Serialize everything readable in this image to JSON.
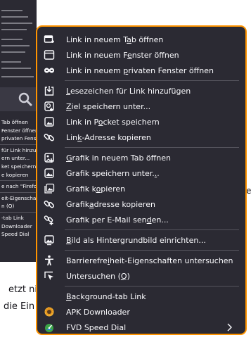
{
  "background": {
    "left_fragments": [
      "etzt nix",
      "die Ein"
    ],
    "right_fragment": "e.",
    "partial_menu_items": [
      "Tab öffnen",
      "Fenster öffnen",
      "privaten Fenst",
      "",
      "für Link hinzufü",
      "ern unter...",
      "ket speichern",
      "e kopieren",
      "",
      "e nach \"Firefox\"",
      "",
      "eit-Eigenschaften",
      "n (Q)",
      "",
      "-tab Link",
      "Downloader",
      "Speed Dial"
    ]
  },
  "context_menu": {
    "groups": [
      [
        {
          "label": "Link in neuem Tab öffnen",
          "icon": "new-tab-icon"
        },
        {
          "label": "Link in neuem Fenster öffnen",
          "icon": "new-window-icon"
        },
        {
          "label": "Link in neuem privaten Fenster öffnen",
          "icon": "private-mask-icon"
        }
      ],
      [
        {
          "label": "Lesezeichen für Link hinzufügen",
          "icon": "bookmark-add-icon"
        },
        {
          "label": "Ziel speichern unter...",
          "icon": "save-icon"
        },
        {
          "label": "Link in Pocket speichern",
          "icon": "pocket-icon"
        },
        {
          "label": "Link-Adresse kopieren",
          "icon": "link-icon"
        }
      ],
      [
        {
          "label": "Grafik in neuem Tab öffnen",
          "icon": "image-new-tab-icon"
        },
        {
          "label": "Grafik speichern unter...",
          "icon": "image-save-icon"
        },
        {
          "label": "Grafik kopieren",
          "icon": "image-copy-icon"
        },
        {
          "label": "Grafikadresse kopieren",
          "icon": "link-icon"
        },
        {
          "label": "Grafik per E-Mail senden...",
          "icon": "email-link-icon"
        }
      ],
      [
        {
          "label": "Bild als Hintergrundbild einrichten...",
          "icon": "wallpaper-icon"
        }
      ],
      [
        {
          "label": "Barrierefreiheit-Eigenschaften untersuchen",
          "icon": "accessibility-icon"
        },
        {
          "label": "Untersuchen (Q)",
          "icon": "inspect-cursor-icon"
        }
      ],
      [
        {
          "label": "Background-tab Link",
          "icon": ""
        },
        {
          "label": "APK Downloader",
          "icon": "apk-downloader-icon"
        },
        {
          "label": "FVD Speed Dial",
          "icon": "fvd-speed-dial-icon",
          "submenu": true
        }
      ]
    ]
  },
  "colors": {
    "menu_bg": "#2b2a33",
    "menu_border": "#ff9400",
    "text": "#fbfbfe",
    "separator": "#55545d"
  }
}
